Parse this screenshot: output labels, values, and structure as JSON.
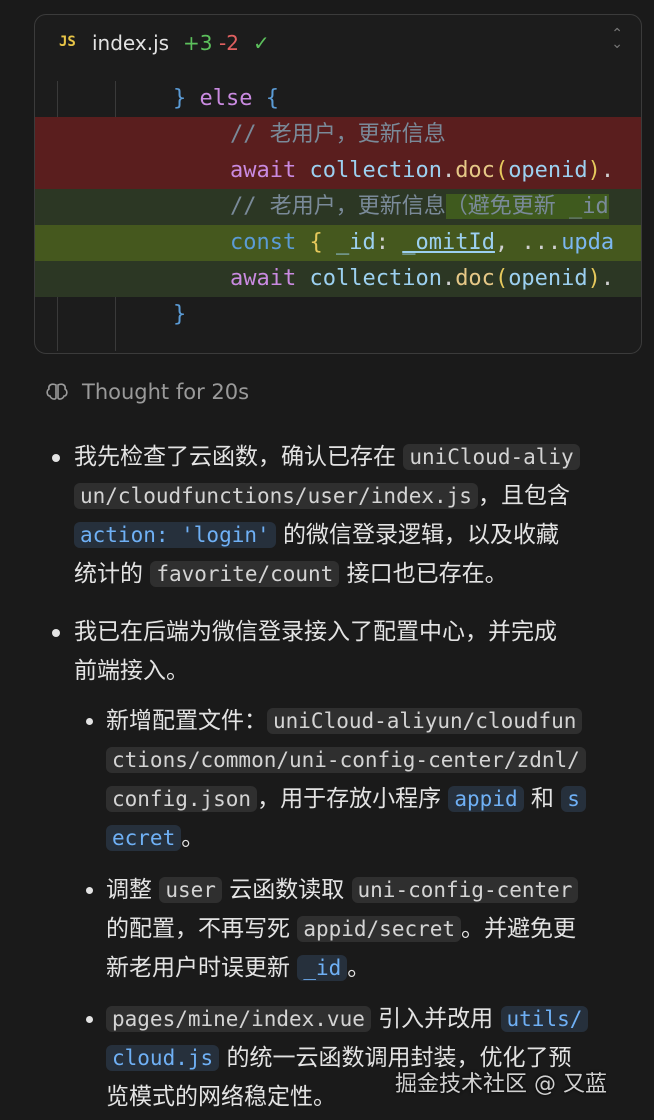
{
  "file_card": {
    "badge": "JS",
    "filename": "index.js",
    "additions": "+3",
    "deletions": "-2",
    "status_icon": "check-icon",
    "expand_icon": "chevron-up-down-icon"
  },
  "code_lines": [
    {
      "kind": "context",
      "text": "} else {"
    },
    {
      "kind": "removed",
      "text": "// 老用户，更新信息"
    },
    {
      "kind": "removed",
      "text": "await collection.doc(openid)."
    },
    {
      "kind": "added",
      "text": "// 老用户，更新信息（避免更新 _id"
    },
    {
      "kind": "added",
      "text": "const { _id: _omitId, ...upda"
    },
    {
      "kind": "added",
      "text": "await collection.doc(openid)."
    },
    {
      "kind": "context",
      "text": "}"
    }
  ],
  "thought": {
    "icon": "brain-icon",
    "label": "Thought for 20s"
  },
  "p1": {
    "l1a": "我先检查了云函数，确认已存在 ",
    "l1code": "uniCloud-aliy",
    "l2code": "un/cloudfunctions/user/index.js",
    "l2b": "，且包含",
    "l3code": "action: 'login'",
    "l3b": " 的微信登录逻辑，以及收藏",
    "l4a": "统计的 ",
    "l4code": "favorite/count",
    "l4b": " 接口也已存在。"
  },
  "p2": {
    "l1": "我已在后端为微信登录接入了配置中心，并完成",
    "l2": "前端接入。"
  },
  "s1": {
    "l1a": "新增配置文件：",
    "l1code": "uniCloud-aliyun/cloudfun",
    "l2code": "ctions/common/uni-config-center/zdnl/",
    "l3code": "config.json",
    "l3b": "，用于存放小程序 ",
    "l3code2": "appid",
    "l3c": " 和 ",
    "l3code3": "s",
    "l4code": "ecret",
    "l4b": "。"
  },
  "s2": {
    "l1a": "调整 ",
    "l1code": "user",
    "l1b": " 云函数读取 ",
    "l1code2": "uni-config-center",
    "l2a": "的配置，不再写死 ",
    "l2code": "appid/secret",
    "l2b": "。并避免更",
    "l3a": "新老用户时误更新 ",
    "l3code": "_id",
    "l3b": "。"
  },
  "s3": {
    "l1code": "pages/mine/index.vue",
    "l1b": " 引入并改用 ",
    "l1code2": "utils/",
    "l2code": "cloud.js",
    "l2b": " 的统一云函数调用封装，优化了预",
    "l3a": "览模式的网络稳定性。"
  },
  "watermark": "掘金技术社区 @ 又蓝"
}
